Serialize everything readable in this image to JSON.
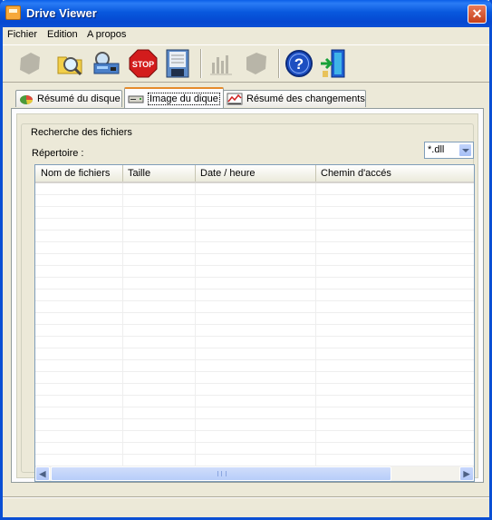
{
  "window": {
    "title": "Drive Viewer"
  },
  "menu": [
    "Fichier",
    "Edition",
    "A propos"
  ],
  "toolbar": {
    "buttons": [
      {
        "icon": "drive-shape-icon",
        "enabled": false
      },
      {
        "icon": "folder-search-icon",
        "enabled": true
      },
      {
        "icon": "scanner-icon",
        "enabled": true
      },
      {
        "icon": "stop-icon",
        "label": "STOP",
        "enabled": true
      },
      {
        "icon": "floppy-save-icon",
        "enabled": true
      },
      {
        "icon": "bar-chart-icon",
        "enabled": false
      },
      {
        "icon": "drive-shape-icon",
        "enabled": false
      },
      {
        "icon": "help-icon",
        "label": "?",
        "enabled": true
      },
      {
        "icon": "exit-door-icon",
        "enabled": true
      }
    ]
  },
  "tabs": [
    {
      "label": "Résumé du disque",
      "icon": "pie-chart-icon",
      "active": false
    },
    {
      "label": "Image du dique",
      "icon": "drive-icon",
      "active": true
    },
    {
      "label": "Résumé des changements",
      "icon": "changes-chart-icon",
      "active": false
    }
  ],
  "search": {
    "group_title": "Recherche des fichiers",
    "directory_label": "Répertoire :",
    "filter_value": "*.dll"
  },
  "file_list": {
    "columns": [
      "Nom de fichiers",
      "Taille",
      "Date / heure",
      "Chemin d'accés"
    ],
    "rows": []
  },
  "colors": {
    "titlebar": "#0a4fd4",
    "stop": "#d31c1c",
    "help": "#1d4fc1"
  }
}
